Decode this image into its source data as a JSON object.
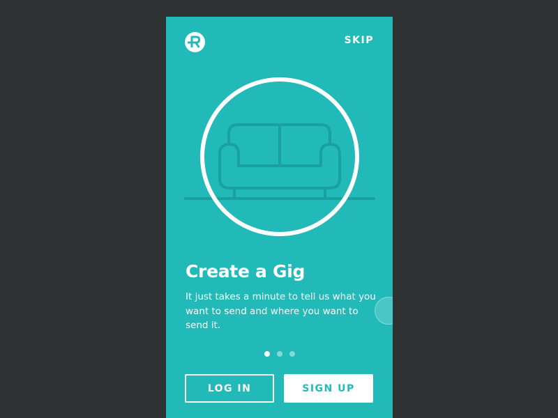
{
  "header": {
    "logo_icon": "r-logo-icon",
    "skip_label": "SKIP"
  },
  "onboarding": {
    "illustration_icon": "couch-icon",
    "title": "Create a Gig",
    "description": "It just takes a minute to tell us what you want to send and where you want to send it.",
    "page_indicator": {
      "total": 3,
      "current": 1
    }
  },
  "actions": {
    "login_label": "LOG IN",
    "signup_label": "SIGN UP"
  },
  "colors": {
    "background": "#2f3233",
    "primary_teal": "#21bab9",
    "dark_teal_line": "#18a19f",
    "white": "#ffffff"
  }
}
